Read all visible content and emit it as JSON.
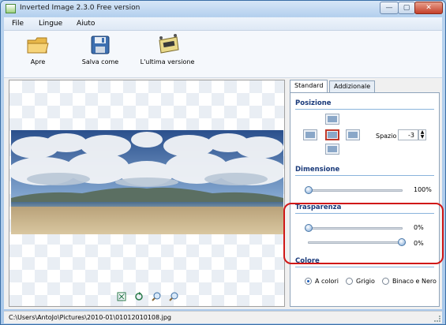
{
  "window": {
    "title": "Inverted Image 2.3.0 Free version",
    "controls": {
      "minimize": "—",
      "maximize": "▢",
      "close": "✕"
    }
  },
  "menu": [
    "File",
    "Lingue",
    "Aiuto"
  ],
  "toolbar": {
    "open_label": "Apre",
    "save_label": "Salva come",
    "latest_label": "L'ultima versione"
  },
  "tabs": {
    "standard": "Standard",
    "additional": "Addizionale"
  },
  "position": {
    "section": "Posizione",
    "selected": "center",
    "spacing_label": "Spazio",
    "spacing_value": "-3"
  },
  "dimension": {
    "section": "Dimensione",
    "value_label": "100%",
    "value": 100
  },
  "transparency": {
    "section": "Trasparenza",
    "slider1_label": "0%",
    "slider1_value": 0,
    "slider2_label": "0%",
    "slider2_value": 0
  },
  "color": {
    "section": "Colore",
    "options": [
      "A colori",
      "Grigio",
      "Binaco e Nero"
    ],
    "selected": "A colori"
  },
  "status": {
    "path": "C:\\Users\\AntoJo\\Pictures\\2010-01\\01012010108.jpg"
  },
  "icons": [
    "app-icon",
    "folder-open-icon",
    "floppy-save-icon",
    "update-icon",
    "fit-icon",
    "rotate-icon",
    "zoom-in-icon",
    "zoom-out-icon"
  ]
}
